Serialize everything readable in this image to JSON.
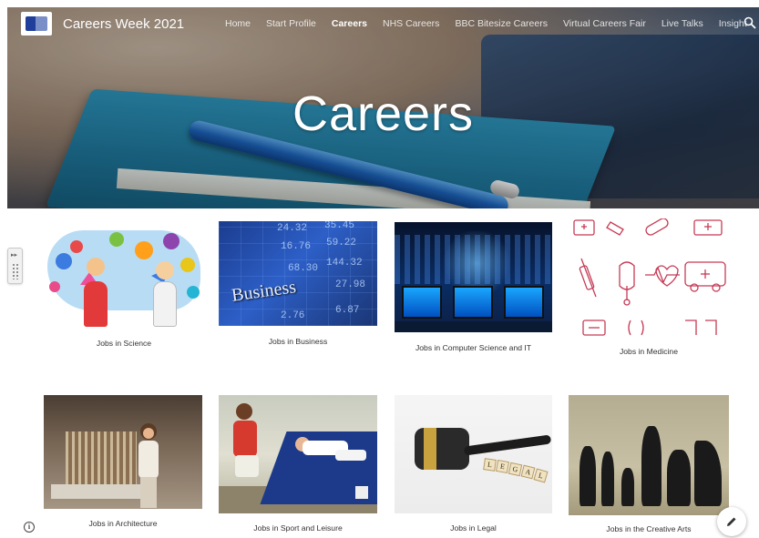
{
  "site": {
    "title": "Careers Week 2021"
  },
  "nav": {
    "items": [
      {
        "label": "Home"
      },
      {
        "label": "Start Profile"
      },
      {
        "label": "Careers",
        "active": true
      },
      {
        "label": "NHS Careers"
      },
      {
        "label": "BBC Bitesize Careers"
      },
      {
        "label": "Virtual Careers Fair"
      },
      {
        "label": "Live Talks"
      },
      {
        "label": "Insight"
      }
    ],
    "search_icon": "search-icon"
  },
  "hero": {
    "title": "Careers"
  },
  "tiles": [
    {
      "caption": "Jobs in Science"
    },
    {
      "caption": "Jobs in Business"
    },
    {
      "caption": "Jobs in Computer Science and IT"
    },
    {
      "caption": "Jobs in Medicine"
    },
    {
      "caption": "Jobs in Architecture"
    },
    {
      "caption": "Jobs in Sport and Leisure"
    },
    {
      "caption": "Jobs in Legal"
    },
    {
      "caption": "Jobs in the Creative Arts"
    }
  ],
  "business_image": {
    "word": "Business",
    "numbers": [
      "24.32",
      "35.45",
      "16.76",
      "59.22",
      "68.30",
      "144.32",
      "27.98",
      "6.87",
      "2.76"
    ]
  },
  "legal_image": {
    "tiles": [
      "L",
      "E",
      "G",
      "A",
      "L"
    ]
  },
  "icons": {
    "info": "info-icon",
    "edit": "pencil-icon",
    "side_toggle": "sidebar-toggle-icon"
  },
  "colors": {
    "nav_active": "#ffffff",
    "hero_text": "#ffffff",
    "caption": "#333333",
    "medicine_icon": "#c63b56"
  }
}
